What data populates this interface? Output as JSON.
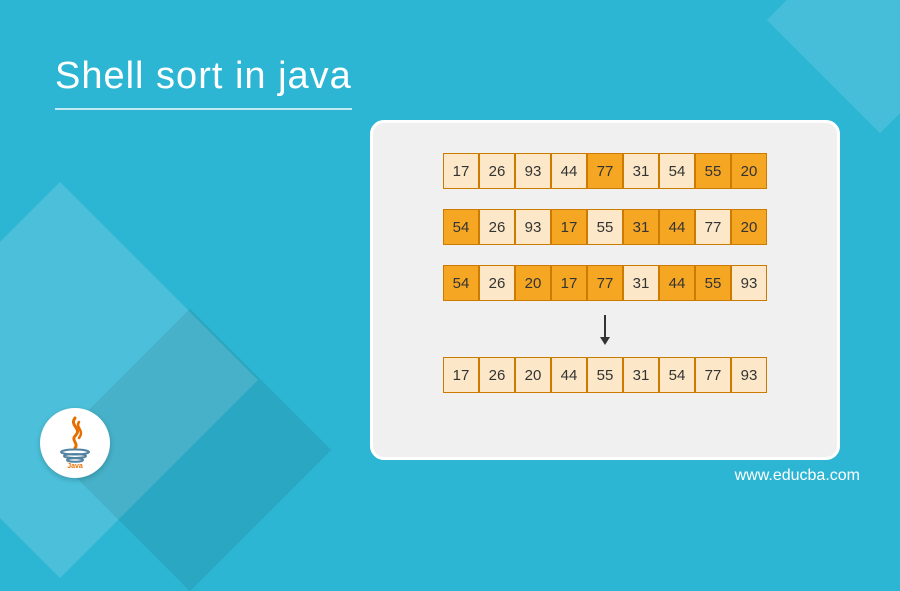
{
  "title": "Shell sort in java",
  "domain_text": "www.educba.com",
  "logo_label": "Java",
  "colors": {
    "background": "#2db6d4",
    "panel": "#f0f0f0",
    "cell_dark": "#f5a623",
    "cell_light": "#fce8c8",
    "cell_border": "#cc7a00"
  },
  "chart_data": {
    "type": "table",
    "title": "Shell sort in java",
    "description": "Four array states illustrating the Shell sort algorithm: three intermediate passes with highlighted gap elements followed by the final sorted array.",
    "rows": [
      {
        "values": [
          17,
          26,
          93,
          44,
          77,
          31,
          54,
          55,
          20
        ],
        "highlighted": [
          "lt",
          "lt",
          "lt",
          "lt",
          "dk",
          "lt",
          "lt",
          "dk",
          "dk"
        ]
      },
      {
        "values": [
          54,
          26,
          93,
          17,
          55,
          31,
          44,
          77,
          20
        ],
        "highlighted": [
          "dk",
          "lt",
          "lt",
          "dk",
          "lt",
          "dk",
          "dk",
          "lt",
          "dk"
        ]
      },
      {
        "values": [
          54,
          26,
          20,
          17,
          77,
          31,
          44,
          55,
          93
        ],
        "highlighted": [
          "dk",
          "lt",
          "dk",
          "dk",
          "dk",
          "lt",
          "dk",
          "dk",
          "lt"
        ]
      },
      {
        "values": [
          17,
          26,
          20,
          44,
          55,
          31,
          54,
          77,
          93
        ],
        "highlighted": [
          "lt",
          "lt",
          "lt",
          "lt",
          "lt",
          "lt",
          "lt",
          "lt",
          "lt"
        ]
      }
    ],
    "arrow_after_row": 2
  }
}
